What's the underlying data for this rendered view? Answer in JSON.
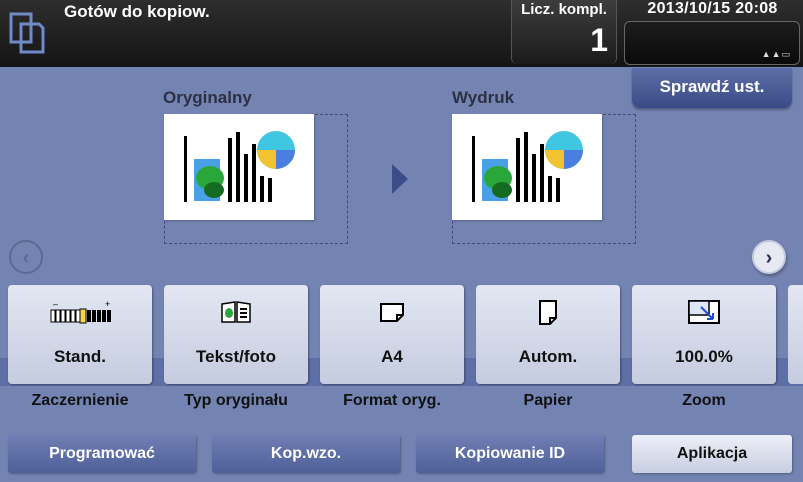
{
  "header": {
    "status": "Gotów do kopiow.",
    "counter_label": "Licz. kompl.",
    "counter_value": "1",
    "datetime": "2013/10/15 20:08",
    "panel_glyph": "▲▲▭"
  },
  "check_settings_label": "Sprawdź ust.",
  "preview": {
    "original_label": "Oryginalny",
    "output_label": "Wydruk"
  },
  "nav": {
    "prev": "‹",
    "next": "›"
  },
  "functions": [
    {
      "value": "Stand.",
      "label": "Zaczernienie",
      "icon": "density-scale-icon"
    },
    {
      "value": "Tekst/foto",
      "label": "Typ oryginału",
      "icon": "text-photo-icon"
    },
    {
      "value": "A4",
      "label": "Format oryg.",
      "icon": "original-size-icon"
    },
    {
      "value": "Autom.",
      "label": "Papier",
      "icon": "paper-icon"
    },
    {
      "value": "100.0%",
      "label": "Zoom",
      "icon": "zoom-icon"
    }
  ],
  "bottom": {
    "program": "Programować",
    "proof": "Kop.wzo.",
    "id_copy": "Kopiowanie ID",
    "application": "Aplikacja"
  },
  "colors": {
    "background": "#7484b2",
    "topbar": "#1a1a1a",
    "accent": "#3c4c88",
    "pie_cyan": "#3fc6e0",
    "pie_yellow": "#f2c230",
    "pie_blue": "#4a7fe0",
    "leaf_green": "#2aa73a"
  }
}
